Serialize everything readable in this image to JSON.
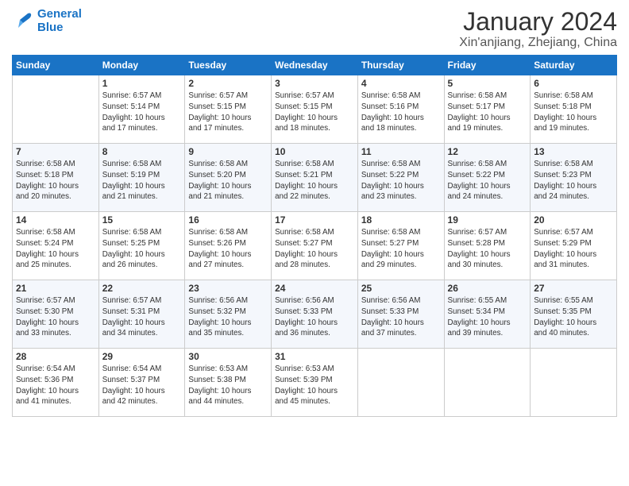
{
  "header": {
    "logo_line1": "General",
    "logo_line2": "Blue",
    "month_title": "January 2024",
    "location": "Xin'anjiang, Zhejiang, China"
  },
  "weekdays": [
    "Sunday",
    "Monday",
    "Tuesday",
    "Wednesday",
    "Thursday",
    "Friday",
    "Saturday"
  ],
  "weeks": [
    [
      {
        "day": "",
        "sunrise": "",
        "sunset": "",
        "daylight": ""
      },
      {
        "day": "1",
        "sunrise": "Sunrise: 6:57 AM",
        "sunset": "Sunset: 5:14 PM",
        "daylight": "Daylight: 10 hours and 17 minutes."
      },
      {
        "day": "2",
        "sunrise": "Sunrise: 6:57 AM",
        "sunset": "Sunset: 5:15 PM",
        "daylight": "Daylight: 10 hours and 17 minutes."
      },
      {
        "day": "3",
        "sunrise": "Sunrise: 6:57 AM",
        "sunset": "Sunset: 5:15 PM",
        "daylight": "Daylight: 10 hours and 18 minutes."
      },
      {
        "day": "4",
        "sunrise": "Sunrise: 6:58 AM",
        "sunset": "Sunset: 5:16 PM",
        "daylight": "Daylight: 10 hours and 18 minutes."
      },
      {
        "day": "5",
        "sunrise": "Sunrise: 6:58 AM",
        "sunset": "Sunset: 5:17 PM",
        "daylight": "Daylight: 10 hours and 19 minutes."
      },
      {
        "day": "6",
        "sunrise": "Sunrise: 6:58 AM",
        "sunset": "Sunset: 5:18 PM",
        "daylight": "Daylight: 10 hours and 19 minutes."
      }
    ],
    [
      {
        "day": "7",
        "sunrise": "Sunrise: 6:58 AM",
        "sunset": "Sunset: 5:18 PM",
        "daylight": "Daylight: 10 hours and 20 minutes."
      },
      {
        "day": "8",
        "sunrise": "Sunrise: 6:58 AM",
        "sunset": "Sunset: 5:19 PM",
        "daylight": "Daylight: 10 hours and 21 minutes."
      },
      {
        "day": "9",
        "sunrise": "Sunrise: 6:58 AM",
        "sunset": "Sunset: 5:20 PM",
        "daylight": "Daylight: 10 hours and 21 minutes."
      },
      {
        "day": "10",
        "sunrise": "Sunrise: 6:58 AM",
        "sunset": "Sunset: 5:21 PM",
        "daylight": "Daylight: 10 hours and 22 minutes."
      },
      {
        "day": "11",
        "sunrise": "Sunrise: 6:58 AM",
        "sunset": "Sunset: 5:22 PM",
        "daylight": "Daylight: 10 hours and 23 minutes."
      },
      {
        "day": "12",
        "sunrise": "Sunrise: 6:58 AM",
        "sunset": "Sunset: 5:22 PM",
        "daylight": "Daylight: 10 hours and 24 minutes."
      },
      {
        "day": "13",
        "sunrise": "Sunrise: 6:58 AM",
        "sunset": "Sunset: 5:23 PM",
        "daylight": "Daylight: 10 hours and 24 minutes."
      }
    ],
    [
      {
        "day": "14",
        "sunrise": "Sunrise: 6:58 AM",
        "sunset": "Sunset: 5:24 PM",
        "daylight": "Daylight: 10 hours and 25 minutes."
      },
      {
        "day": "15",
        "sunrise": "Sunrise: 6:58 AM",
        "sunset": "Sunset: 5:25 PM",
        "daylight": "Daylight: 10 hours and 26 minutes."
      },
      {
        "day": "16",
        "sunrise": "Sunrise: 6:58 AM",
        "sunset": "Sunset: 5:26 PM",
        "daylight": "Daylight: 10 hours and 27 minutes."
      },
      {
        "day": "17",
        "sunrise": "Sunrise: 6:58 AM",
        "sunset": "Sunset: 5:27 PM",
        "daylight": "Daylight: 10 hours and 28 minutes."
      },
      {
        "day": "18",
        "sunrise": "Sunrise: 6:58 AM",
        "sunset": "Sunset: 5:27 PM",
        "daylight": "Daylight: 10 hours and 29 minutes."
      },
      {
        "day": "19",
        "sunrise": "Sunrise: 6:57 AM",
        "sunset": "Sunset: 5:28 PM",
        "daylight": "Daylight: 10 hours and 30 minutes."
      },
      {
        "day": "20",
        "sunrise": "Sunrise: 6:57 AM",
        "sunset": "Sunset: 5:29 PM",
        "daylight": "Daylight: 10 hours and 31 minutes."
      }
    ],
    [
      {
        "day": "21",
        "sunrise": "Sunrise: 6:57 AM",
        "sunset": "Sunset: 5:30 PM",
        "daylight": "Daylight: 10 hours and 33 minutes."
      },
      {
        "day": "22",
        "sunrise": "Sunrise: 6:57 AM",
        "sunset": "Sunset: 5:31 PM",
        "daylight": "Daylight: 10 hours and 34 minutes."
      },
      {
        "day": "23",
        "sunrise": "Sunrise: 6:56 AM",
        "sunset": "Sunset: 5:32 PM",
        "daylight": "Daylight: 10 hours and 35 minutes."
      },
      {
        "day": "24",
        "sunrise": "Sunrise: 6:56 AM",
        "sunset": "Sunset: 5:33 PM",
        "daylight": "Daylight: 10 hours and 36 minutes."
      },
      {
        "day": "25",
        "sunrise": "Sunrise: 6:56 AM",
        "sunset": "Sunset: 5:33 PM",
        "daylight": "Daylight: 10 hours and 37 minutes."
      },
      {
        "day": "26",
        "sunrise": "Sunrise: 6:55 AM",
        "sunset": "Sunset: 5:34 PM",
        "daylight": "Daylight: 10 hours and 39 minutes."
      },
      {
        "day": "27",
        "sunrise": "Sunrise: 6:55 AM",
        "sunset": "Sunset: 5:35 PM",
        "daylight": "Daylight: 10 hours and 40 minutes."
      }
    ],
    [
      {
        "day": "28",
        "sunrise": "Sunrise: 6:54 AM",
        "sunset": "Sunset: 5:36 PM",
        "daylight": "Daylight: 10 hours and 41 minutes."
      },
      {
        "day": "29",
        "sunrise": "Sunrise: 6:54 AM",
        "sunset": "Sunset: 5:37 PM",
        "daylight": "Daylight: 10 hours and 42 minutes."
      },
      {
        "day": "30",
        "sunrise": "Sunrise: 6:53 AM",
        "sunset": "Sunset: 5:38 PM",
        "daylight": "Daylight: 10 hours and 44 minutes."
      },
      {
        "day": "31",
        "sunrise": "Sunrise: 6:53 AM",
        "sunset": "Sunset: 5:39 PM",
        "daylight": "Daylight: 10 hours and 45 minutes."
      },
      {
        "day": "",
        "sunrise": "",
        "sunset": "",
        "daylight": ""
      },
      {
        "day": "",
        "sunrise": "",
        "sunset": "",
        "daylight": ""
      },
      {
        "day": "",
        "sunrise": "",
        "sunset": "",
        "daylight": ""
      }
    ]
  ]
}
